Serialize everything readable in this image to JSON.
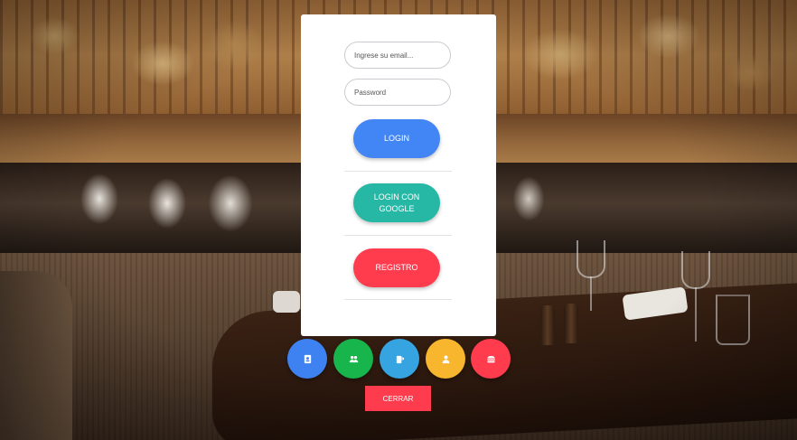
{
  "login_form": {
    "email_placeholder": "Ingrese su email...",
    "password_placeholder": "Password",
    "login_label": "LOGIN",
    "google_label": "LOGIN CON GOOGLE",
    "register_label": "REGISTRO"
  },
  "colors": {
    "login": "#4285f4",
    "google": "#26b8a5",
    "register": "#ff3b4e"
  },
  "fab_row": [
    {
      "icon": "contact-book-icon",
      "color": "#3d82f0"
    },
    {
      "icon": "group-icon",
      "color": "#17b54b"
    },
    {
      "icon": "beer-mug-icon",
      "color": "#36a4e0"
    },
    {
      "icon": "person-icon",
      "color": "#f8b62e"
    },
    {
      "icon": "burger-icon",
      "color": "#ff3b4e"
    }
  ],
  "close_label": "CERRAR"
}
